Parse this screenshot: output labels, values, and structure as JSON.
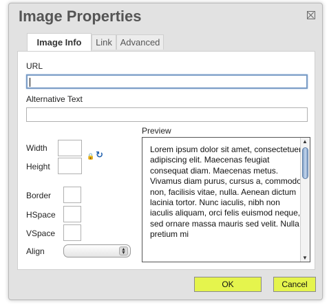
{
  "dialog": {
    "title": "Image Properties",
    "close_icon": "close-icon"
  },
  "tabs": [
    {
      "label": "Image Info",
      "active": true
    },
    {
      "label": "Link",
      "active": false
    },
    {
      "label": "Advanced",
      "active": false
    }
  ],
  "fields": {
    "url_label": "URL",
    "url_value": "",
    "alt_label": "Alternative Text",
    "alt_value": "",
    "width_label": "Width",
    "width_value": "",
    "height_label": "Height",
    "height_value": "",
    "border_label": "Border",
    "border_value": "",
    "hspace_label": "HSpace",
    "hspace_value": "",
    "vspace_label": "VSpace",
    "vspace_value": "",
    "align_label": "Align",
    "align_value": "",
    "lock_icon": "lock-icon",
    "reset_icon": "reset-size-icon"
  },
  "preview": {
    "label": "Preview",
    "text": "Lorem ipsum dolor sit amet, consectetuer adipiscing elit. Maecenas feugiat consequat diam. Maecenas metus. Vivamus diam purus, cursus a, commodo non, facilisis vitae, nulla. Aenean dictum lacinia tortor. Nunc iaculis, nibh non iaculis aliquam, orci felis euismod neque, sed ornare massa mauris sed velit. Nulla pretium mi"
  },
  "buttons": {
    "ok": "OK",
    "cancel": "Cancel"
  },
  "colors": {
    "button_bg": "#e5f44d",
    "focus_border": "#7a9cc6",
    "dialog_bg": "#e2e2e2"
  }
}
